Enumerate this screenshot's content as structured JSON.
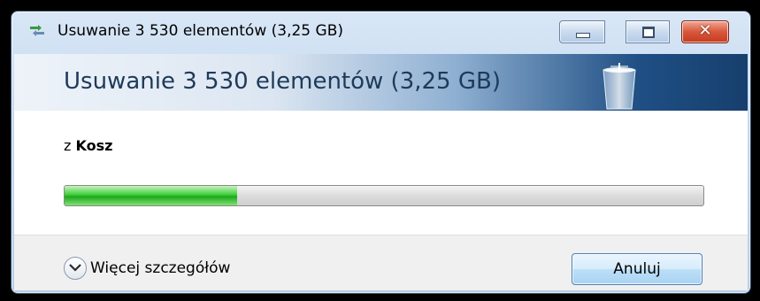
{
  "window": {
    "title": "Usuwanie 3 530 elementów (3,25 GB)",
    "controls": {
      "minimize": "minimize",
      "maximize": "maximize",
      "close": "✕"
    }
  },
  "header": {
    "title": "Usuwanie 3 530 elementów (3,25 GB)",
    "icon": "recycle-bin-icon"
  },
  "content": {
    "from_prefix": "z",
    "from_location": "Kosz",
    "progress_fraction": 0.27
  },
  "footer": {
    "details_label": "Więcej szczegółów",
    "cancel_label": "Anuluj"
  },
  "colors": {
    "progress_green": "#2cc02a",
    "close_red": "#d8573b",
    "header_dark_blue": "#173f6d"
  }
}
